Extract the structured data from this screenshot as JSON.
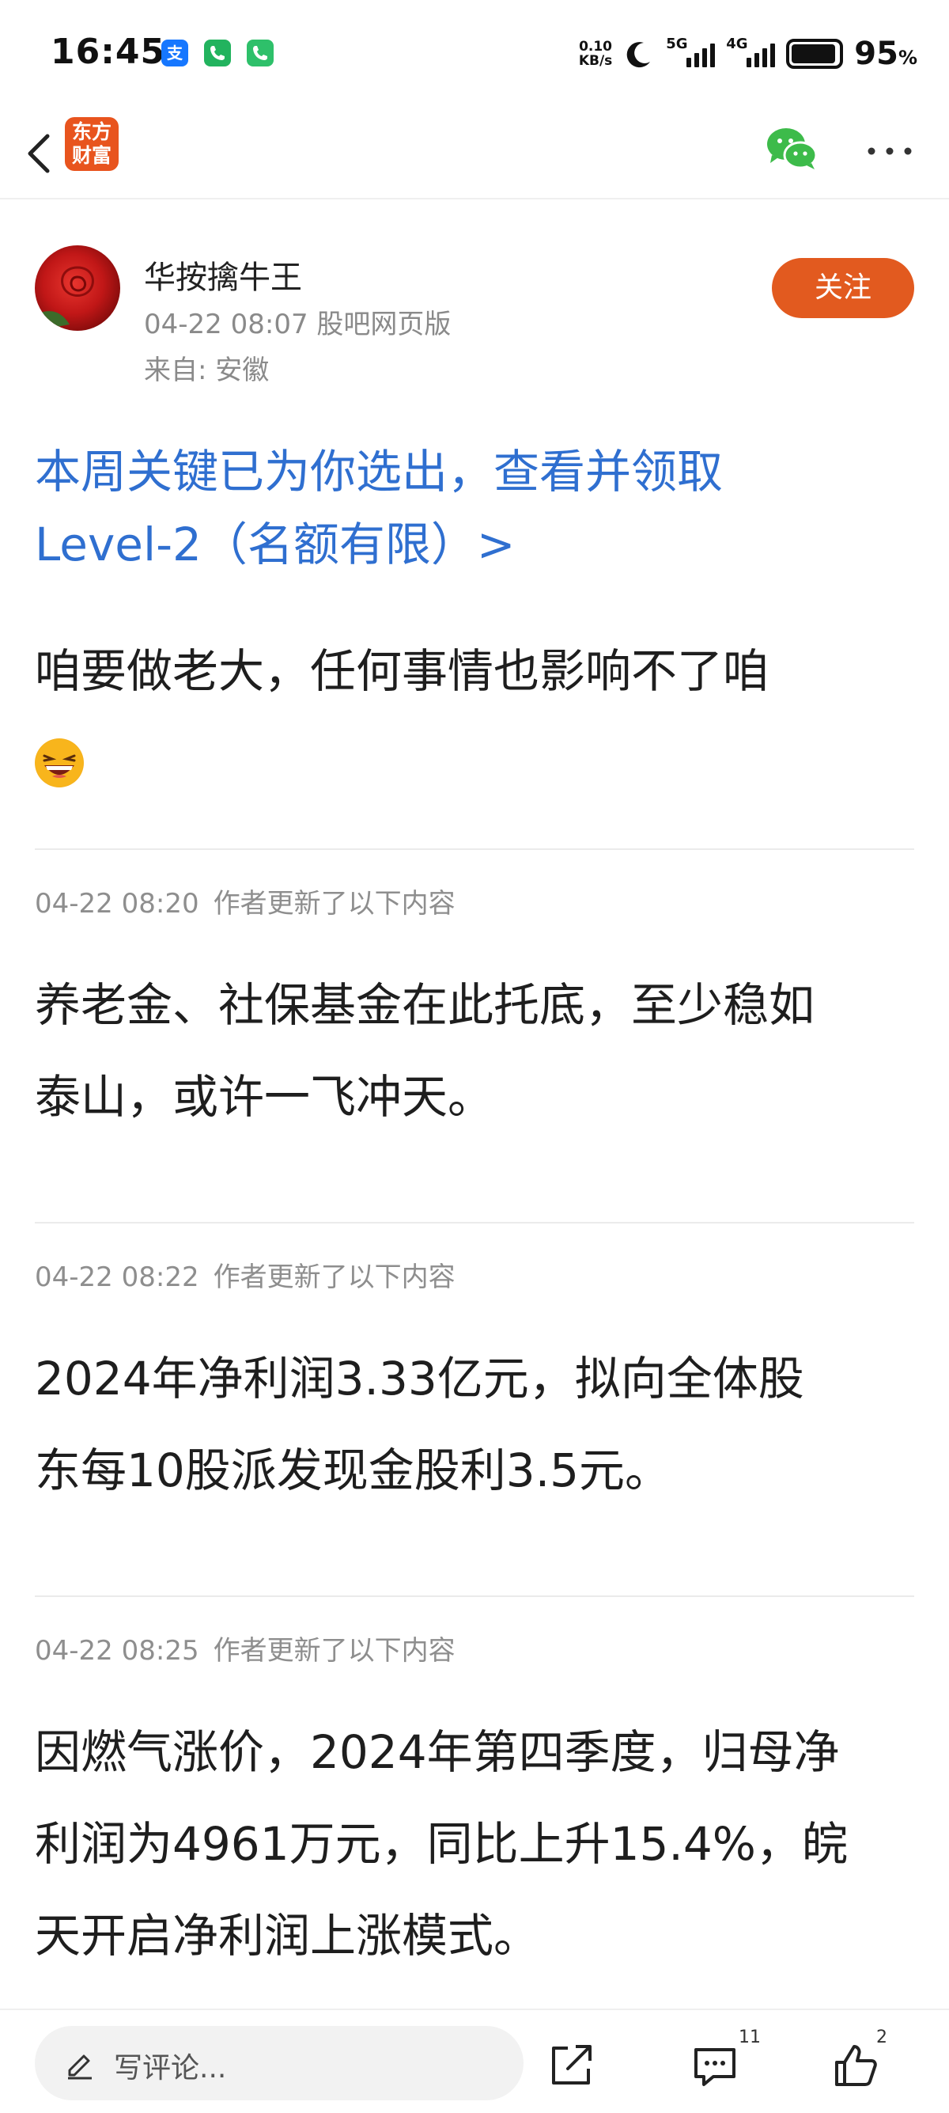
{
  "status_bar": {
    "time": "16:45",
    "app_icons": [
      "alipay-icon",
      "phone-icon",
      "phone-icon"
    ],
    "net_speed_value": "0.10",
    "net_speed_unit": "KB/s",
    "signal_1_label": "5G",
    "signal_2_label": "4G",
    "battery_percent": "95",
    "battery_unit": "%"
  },
  "nav": {
    "logo_line1": "东方",
    "logo_line2": "财富"
  },
  "author": {
    "name": "华按擒牛王",
    "meta": "04-22 08:07 股吧网页版",
    "from": "来自: 安徽",
    "follow_label": "关注"
  },
  "promo": {
    "line1": "本周关键已为你选出，查看并领取",
    "line2": "Level-2（名额有限）>"
  },
  "post": {
    "body": "咱要做老大，任何事情也影响不了咱"
  },
  "updates": [
    {
      "time": "04-22 08:20",
      "label": "作者更新了以下内容",
      "line1": "养老金、社保基金在此托底，至少稳如",
      "line2": "泰山，或许一飞冲天。"
    },
    {
      "time": "04-22 08:22",
      "label": "作者更新了以下内容",
      "line1": "2024年净利润3.33亿元，拟向全体股",
      "line2": "东每10股派发现金股利3.5元。"
    },
    {
      "time": "04-22 08:25",
      "label": "作者更新了以下内容",
      "line1": "因燃气涨价，2024年第四季度，归母净",
      "line2": "利润为4961万元，同比上升15.4%，皖",
      "line3": "天开启净利润上涨模式。"
    }
  ],
  "bottom_bar": {
    "comment_placeholder": "写评论...",
    "comment_count": "11",
    "like_count": "2"
  }
}
